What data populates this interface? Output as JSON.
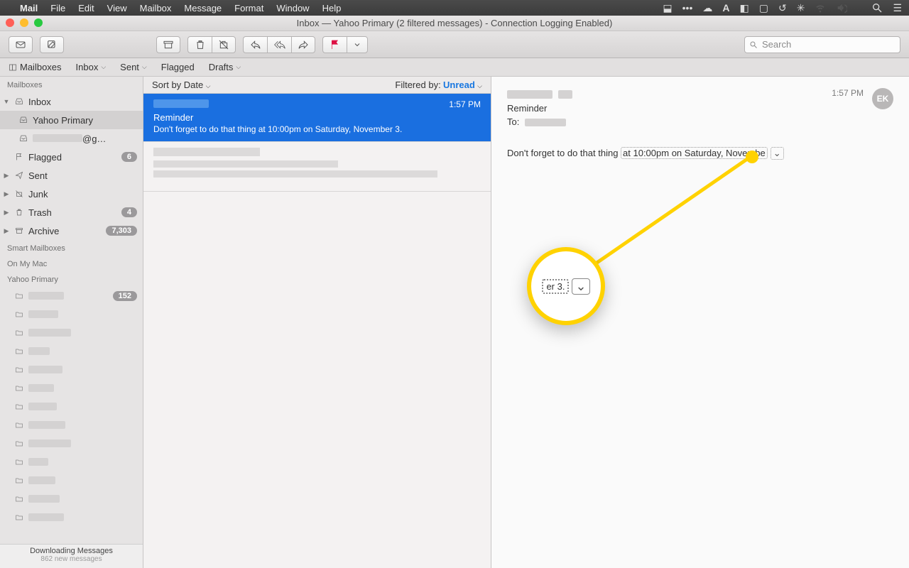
{
  "menubar": {
    "app": "Mail",
    "items": [
      "File",
      "Edit",
      "View",
      "Mailbox",
      "Message",
      "Format",
      "Window",
      "Help"
    ]
  },
  "window": {
    "title": "Inbox — Yahoo Primary (2 filtered messages) - Connection Logging Enabled)"
  },
  "toolbar": {
    "search_placeholder": "Search"
  },
  "favbar": {
    "mailboxes": "Mailboxes",
    "inbox": "Inbox",
    "sent": "Sent",
    "flagged": "Flagged",
    "drafts": "Drafts"
  },
  "sidebar": {
    "hdr_mailboxes": "Mailboxes",
    "inbox": "Inbox",
    "yahoo_primary": "Yahoo Primary",
    "gmail_suffix": "@g…",
    "flagged": "Flagged",
    "flagged_count": "6",
    "sent": "Sent",
    "junk": "Junk",
    "trash": "Trash",
    "trash_count": "4",
    "archive": "Archive",
    "archive_count": "7,303",
    "hdr_smart": "Smart Mailboxes",
    "hdr_onmymac": "On My Mac",
    "hdr_yahoo": "Yahoo Primary",
    "folder_count_1": "152",
    "dl_line1": "Downloading Messages",
    "dl_line2": "862 new messages"
  },
  "msglist": {
    "sort_label": "Sort by Date",
    "filter_prefix": "Filtered by:",
    "filter_value": "Unread",
    "selected": {
      "time": "1:57 PM",
      "subject": "Reminder",
      "preview": "Don't forget to do that thing at 10:00pm on Saturday, November 3."
    }
  },
  "reader": {
    "time": "1:57 PM",
    "avatar": "EK",
    "subject": "Reminder",
    "to_label": "To:",
    "body_prefix": "Don't forget to do that thing ",
    "body_datadetect": "at 10:00pm on Saturday, Novembe",
    "dd_chevron": "⌄"
  },
  "callout": {
    "zoom_text": "er 3.",
    "zoom_chevron": "⌄"
  }
}
